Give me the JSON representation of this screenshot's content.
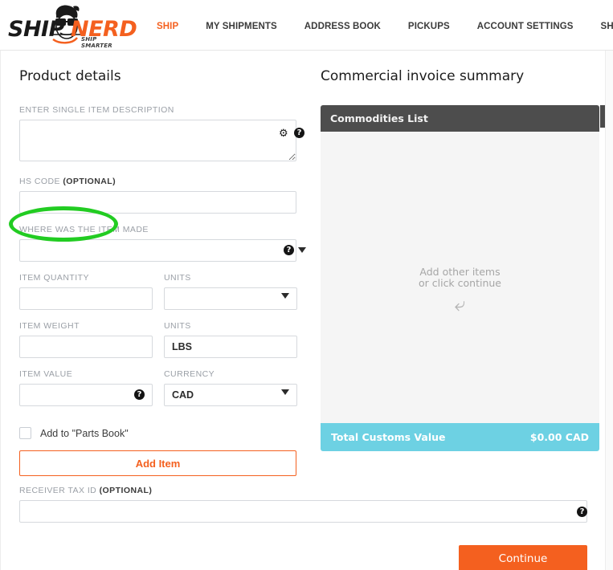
{
  "brand": {
    "logo_ship": "SHIP",
    "logo_nerd": "NERD",
    "logo_tagline": "SHIP SMARTER",
    "accent_orange": "#f4601f",
    "accent_cyan": "#6dd1e3",
    "annotation_green": "#22cc22"
  },
  "nav": {
    "items": [
      {
        "label": "SHIP",
        "active": true
      },
      {
        "label": "MY SHIPMENTS",
        "active": false
      },
      {
        "label": "ADDRESS BOOK",
        "active": false
      },
      {
        "label": "PICKUPS",
        "active": false
      },
      {
        "label": "ACCOUNT SETTINGS",
        "active": false
      },
      {
        "label": "SHIPNERD",
        "active": false
      }
    ]
  },
  "product_details": {
    "title": "Product details",
    "description": {
      "label": "ENTER SINGLE ITEM DESCRIPTION",
      "value": "",
      "placeholder": "",
      "gear_icon": "gear-icon",
      "help_icon": "help-icon"
    },
    "hs_code": {
      "label_main": "HS CODE ",
      "label_optional": "(OPTIONAL)",
      "value": "",
      "placeholder": ""
    },
    "origin": {
      "label": "WHERE WAS THE ITEM MADE",
      "value": "",
      "placeholder": "",
      "help_icon": "help-icon",
      "caret_icon": "chevron-down-icon"
    },
    "item_quantity": {
      "label": "ITEM QUANTITY",
      "value": "",
      "placeholder": ""
    },
    "quantity_units": {
      "label": "UNITS",
      "value": "",
      "placeholder": "",
      "caret_icon": "chevron-down-icon"
    },
    "item_weight": {
      "label": "ITEM WEIGHT",
      "value": "",
      "placeholder": ""
    },
    "weight_units": {
      "label": "UNITS",
      "value": "LBS"
    },
    "item_value": {
      "label": "ITEM VALUE",
      "value": "",
      "placeholder": "",
      "help_icon": "help-icon"
    },
    "currency": {
      "label": "CURRENCY",
      "value": "CAD",
      "caret_icon": "chevron-down-icon"
    },
    "parts_book": {
      "label": "Add to \"Parts Book\"",
      "checked": false
    },
    "add_item_button": "Add Item"
  },
  "invoice_summary": {
    "title": "Commercial invoice summary",
    "commodities_header": "Commodities List",
    "empty_line1": "Add other items",
    "empty_line2": "or click continue",
    "empty_arrow_icon": "curved-arrow-left-icon",
    "total_label": "Total Customs Value",
    "total_value": "$0.00 CAD"
  },
  "bottom": {
    "receiver_tax_id": {
      "label_main": "RECEIVER TAX ID ",
      "label_optional": "(OPTIONAL)",
      "value": "",
      "placeholder": "",
      "help_icon": "help-icon"
    },
    "continue_button": "Continue"
  }
}
